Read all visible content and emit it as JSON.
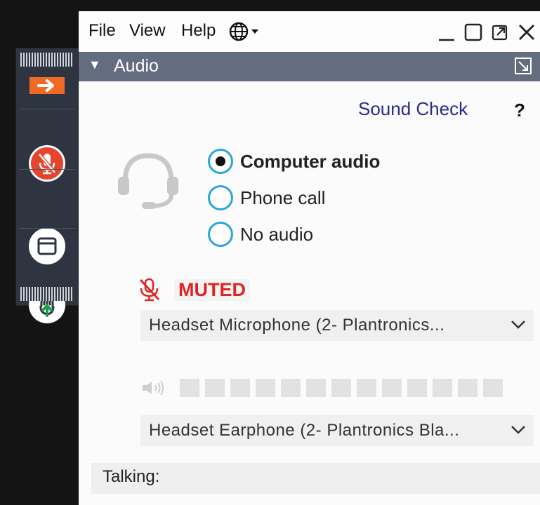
{
  "menu": {
    "file": "File",
    "view": "View",
    "help": "Help"
  },
  "icons": {
    "globe": "globe-icon",
    "minimize": "minimize-icon",
    "maximize": "maximize-icon",
    "restore": "restore-icon",
    "close": "close-icon"
  },
  "audio_panel": {
    "title": "Audio",
    "sound_check": "Sound Check",
    "help": "?",
    "options": [
      {
        "label": "Computer audio",
        "selected": true
      },
      {
        "label": "Phone call",
        "selected": false
      },
      {
        "label": "No audio",
        "selected": false
      }
    ],
    "muted_label": "MUTED",
    "microphone": "Headset Microphone (2- Plantronics...",
    "speaker": "Headset Earphone (2- Plantronics Bla...",
    "level_segments": 13,
    "level_value": 0,
    "talking_label": "Talking:"
  },
  "colors": {
    "accent_orange": "#f06a25",
    "mute_red": "#e02424",
    "radio_blue": "#29a7d6",
    "header_bar": "#646d80",
    "toolbar_bg": "#2e3440"
  }
}
